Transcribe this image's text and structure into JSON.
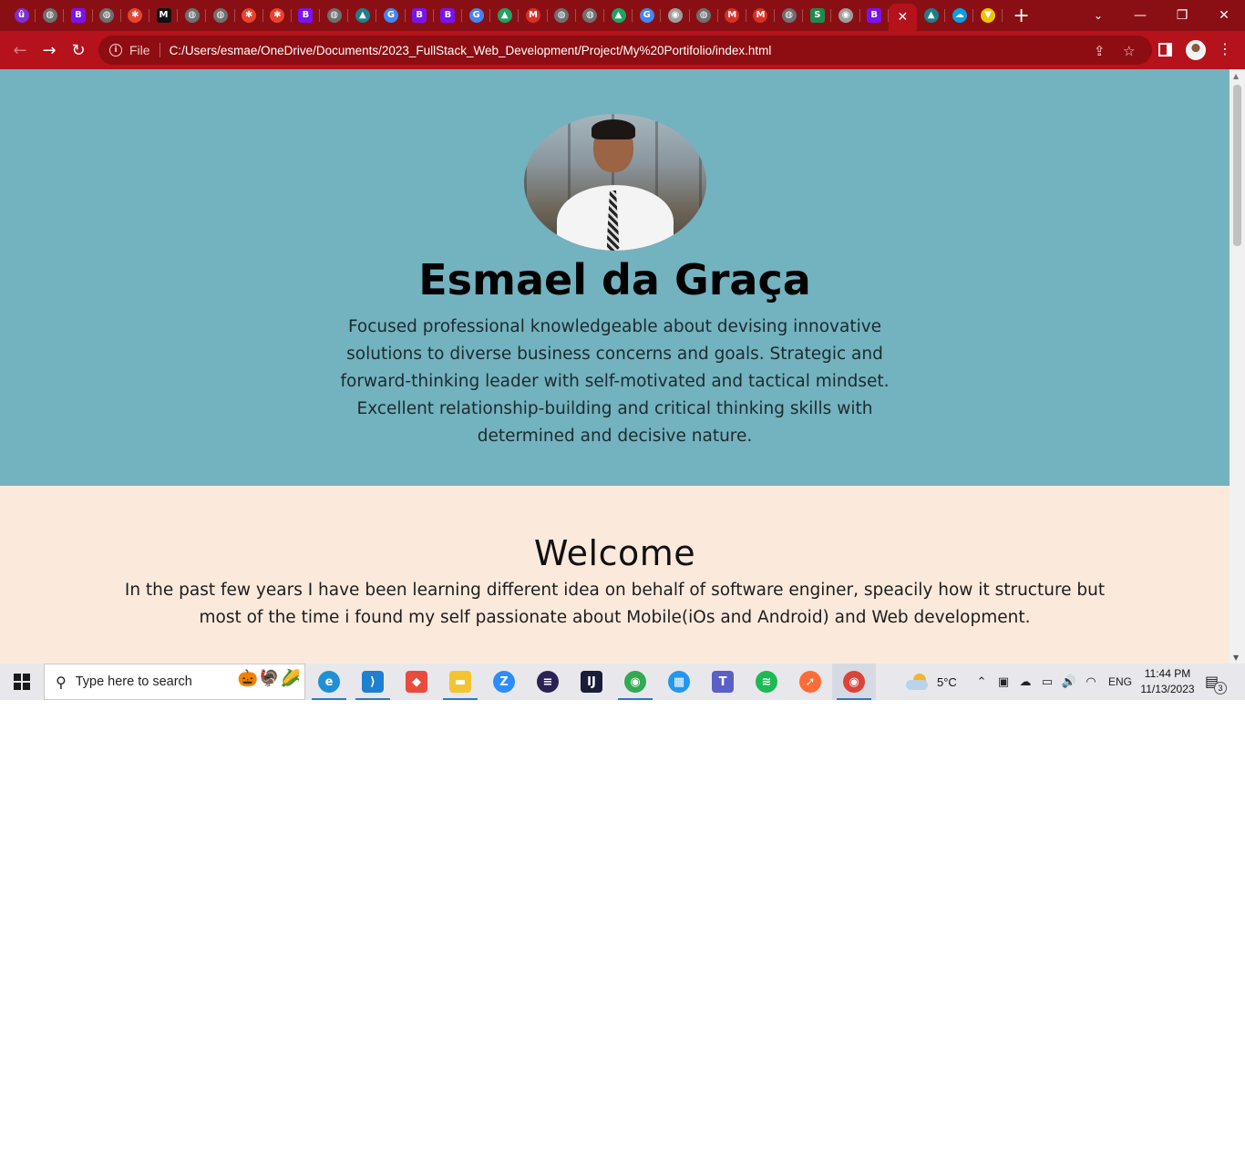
{
  "browser": {
    "tabs": [
      {
        "icon": "tab-favicon-u",
        "glyph": "û",
        "color": "#7b2fd6"
      },
      {
        "icon": "tab-favicon-globe",
        "glyph": "◍",
        "color": "#6f6f6f"
      },
      {
        "icon": "tab-favicon-bootstrap",
        "glyph": "B",
        "color": "#7a12f0"
      },
      {
        "icon": "tab-favicon-globe",
        "glyph": "◍",
        "color": "#6f6f6f"
      },
      {
        "icon": "tab-favicon-asterisk",
        "glyph": "✱",
        "color": "#e8442d"
      },
      {
        "icon": "tab-favicon-medium",
        "glyph": "M",
        "color": "#111111"
      },
      {
        "icon": "tab-favicon-globe",
        "glyph": "◍",
        "color": "#6f6f6f"
      },
      {
        "icon": "tab-favicon-globe",
        "glyph": "◍",
        "color": "#6f6f6f"
      },
      {
        "icon": "tab-favicon-asterisk",
        "glyph": "✱",
        "color": "#e8442d"
      },
      {
        "icon": "tab-favicon-asterisk",
        "glyph": "✱",
        "color": "#e8442d"
      },
      {
        "icon": "tab-favicon-bootstrap",
        "glyph": "B",
        "color": "#7a12f0"
      },
      {
        "icon": "tab-favicon-globe",
        "glyph": "◍",
        "color": "#6f6f6f"
      },
      {
        "icon": "tab-favicon-mountain",
        "glyph": "▲",
        "color": "#1d7f8a"
      },
      {
        "icon": "tab-favicon-google",
        "glyph": "G",
        "color": "#4285f4"
      },
      {
        "icon": "tab-favicon-bootstrap",
        "glyph": "B",
        "color": "#7a12f0"
      },
      {
        "icon": "tab-favicon-bootstrap",
        "glyph": "B",
        "color": "#7a12f0"
      },
      {
        "icon": "tab-favicon-google",
        "glyph": "G",
        "color": "#4285f4"
      },
      {
        "icon": "tab-favicon-drive",
        "glyph": "▲",
        "color": "#1fa463"
      },
      {
        "icon": "tab-favicon-gmail",
        "glyph": "M",
        "color": "#d93025"
      },
      {
        "icon": "tab-favicon-globe",
        "glyph": "◍",
        "color": "#6f6f6f"
      },
      {
        "icon": "tab-favicon-globe",
        "glyph": "◍",
        "color": "#6f6f6f"
      },
      {
        "icon": "tab-favicon-drive",
        "glyph": "▲",
        "color": "#1fa463"
      },
      {
        "icon": "tab-favicon-google",
        "glyph": "G",
        "color": "#4285f4"
      },
      {
        "icon": "tab-favicon-chrome",
        "glyph": "◉",
        "color": "#9e9e9e"
      },
      {
        "icon": "tab-favicon-globe",
        "glyph": "◍",
        "color": "#6f6f6f"
      },
      {
        "icon": "tab-favicon-gmail",
        "glyph": "M",
        "color": "#d93025"
      },
      {
        "icon": "tab-favicon-gmail",
        "glyph": "M",
        "color": "#d93025"
      },
      {
        "icon": "tab-favicon-globe",
        "glyph": "◍",
        "color": "#6f6f6f"
      },
      {
        "icon": "tab-favicon-s",
        "glyph": "S",
        "color": "#1e8a4c"
      },
      {
        "icon": "tab-favicon-chrome",
        "glyph": "◉",
        "color": "#9e9e9e"
      },
      {
        "icon": "tab-favicon-bootstrap",
        "glyph": "B",
        "color": "#7a12f0"
      },
      {
        "icon": "tab-close",
        "glyph": "✕",
        "color": "",
        "active": true
      },
      {
        "icon": "tab-favicon-mountain",
        "glyph": "▲",
        "color": "#1d7f8a"
      },
      {
        "icon": "tab-favicon-salesforce",
        "glyph": "☁",
        "color": "#0a9ee6"
      },
      {
        "icon": "tab-favicon-shield",
        "glyph": "▼",
        "color": "#f2c200"
      }
    ],
    "new_tab_label": "+",
    "window_controls": {
      "tab_search": "⌄",
      "minimize": "—",
      "restore": "❐",
      "close": "✕"
    },
    "nav": {
      "back": "←",
      "forward": "→",
      "reload": "↻"
    },
    "omnibox": {
      "scheme_label": "File",
      "url": "C:/Users/esmae/OneDrive/Documents/2023_FullStack_Web_Development/Project/My%20Portifolio/index.html",
      "share_icon": "⇪",
      "star_icon": "☆"
    },
    "menu_icon": "⋮"
  },
  "page": {
    "hero": {
      "name": "Esmael da Graça",
      "bio": "Focused professional knowledgeable about devising innovative solutions to diverse business concerns and goals. Strategic and forward-thinking leader with self-motivated and tactical mindset. Excellent relationship-building and critical thinking skills with determined and decisive nature.",
      "bg_color": "#73b2bf"
    },
    "welcome": {
      "title": "Welcome",
      "text": "In the past few years I have been learning different idea on behalf of software enginer, speacily how it structure but most of the time i found my self passionate about Mobile(iOs and Android) and Web development.",
      "bg_color": "#fbeadc"
    }
  },
  "taskbar": {
    "search_placeholder": "Type here to search",
    "search_art": [
      "🎃",
      "🦃",
      "🌽"
    ],
    "apps": [
      {
        "name": "edge-icon",
        "glyph": "e",
        "color": "#1f8fd6",
        "running": true
      },
      {
        "name": "vscode-icon",
        "glyph": "⟩",
        "color": "#1f7fd0",
        "running": true,
        "square": true
      },
      {
        "name": "git-icon",
        "glyph": "◆",
        "color": "#e94b3c",
        "running": false,
        "square": true
      },
      {
        "name": "file-explorer-icon",
        "glyph": "▬",
        "color": "#f4c430",
        "running": true,
        "square": true
      },
      {
        "name": "zoom-icon",
        "glyph": "Z",
        "color": "#2d8cff",
        "running": false
      },
      {
        "name": "eclipse-icon",
        "glyph": "≡",
        "color": "#2c2255",
        "running": false
      },
      {
        "name": "intellij-icon",
        "glyph": "IJ",
        "color": "#1b1b3a",
        "running": false,
        "square": true
      },
      {
        "name": "chrome-profile-icon",
        "glyph": "◉",
        "color": "#34a853",
        "running": true
      },
      {
        "name": "docker-icon",
        "glyph": "▦",
        "color": "#2496ed",
        "running": false
      },
      {
        "name": "teams-icon",
        "glyph": "T",
        "color": "#5b5fc7",
        "running": false,
        "square": true
      },
      {
        "name": "spotify-icon",
        "glyph": "≋",
        "color": "#1db954",
        "running": false
      },
      {
        "name": "postman-icon",
        "glyph": "➚",
        "color": "#ff6c37",
        "running": false
      },
      {
        "name": "chrome-icon",
        "glyph": "◉",
        "color": "#db4437",
        "running": true,
        "focused": true
      }
    ],
    "weather_temp": "5°C",
    "tray": {
      "chevron": "⌃",
      "meet": "▣",
      "onedrive": "☁",
      "battery": "▭",
      "volume": "🔊",
      "wifi": "◠",
      "language": "ENG"
    },
    "clock": {
      "time": "11:44 PM",
      "date": "11/13/2023"
    },
    "notifications": {
      "glyph": "▤",
      "count": "3"
    }
  }
}
